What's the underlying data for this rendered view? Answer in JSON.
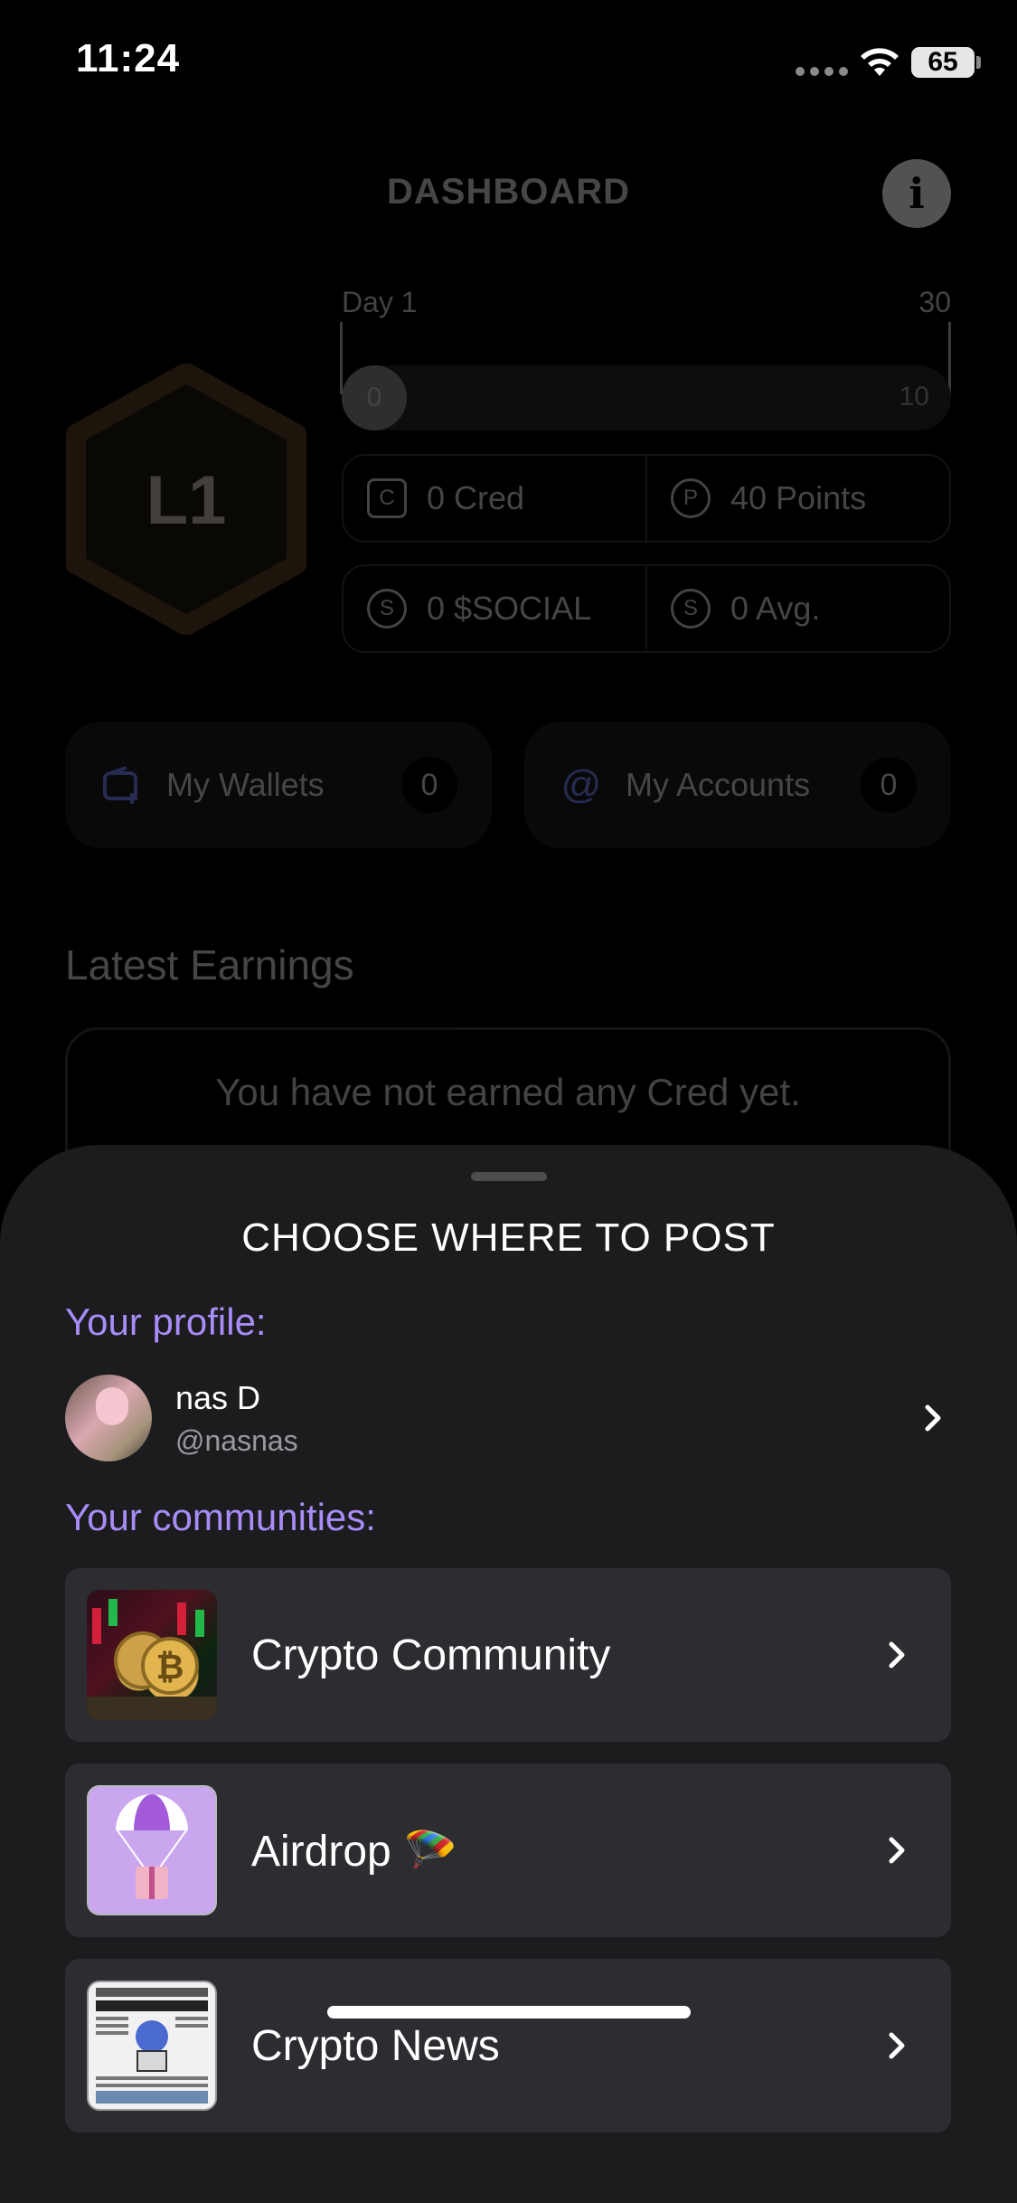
{
  "status_bar": {
    "time": "11:24",
    "battery": "65"
  },
  "dashboard": {
    "title": "DASHBOARD",
    "level": "L1",
    "progress": {
      "day_label": "Day 1",
      "max_day": "30",
      "current": "0",
      "end": "10"
    },
    "stats": [
      {
        "icon": "C",
        "label": "0 Cred"
      },
      {
        "icon": "P",
        "label": "40 Points"
      },
      {
        "icon": "S",
        "label": "0 $SOCIAL"
      },
      {
        "icon": "S",
        "label": "0 Avg."
      }
    ],
    "wallets": {
      "label": "My Wallets",
      "count": "0"
    },
    "accounts": {
      "label": "My Accounts",
      "count": "0"
    },
    "latest_title": "Latest Earnings",
    "earnings_empty": "You have not earned any Cred yet."
  },
  "sheet": {
    "title": "CHOOSE WHERE TO POST",
    "profile_label": "Your profile:",
    "profile": {
      "name": "nas D",
      "handle": "@nasnas"
    },
    "communities_label": "Your communities:",
    "communities": [
      {
        "name": "Crypto Community"
      },
      {
        "name": "Airdrop 🪂"
      },
      {
        "name": "Crypto News"
      }
    ]
  }
}
